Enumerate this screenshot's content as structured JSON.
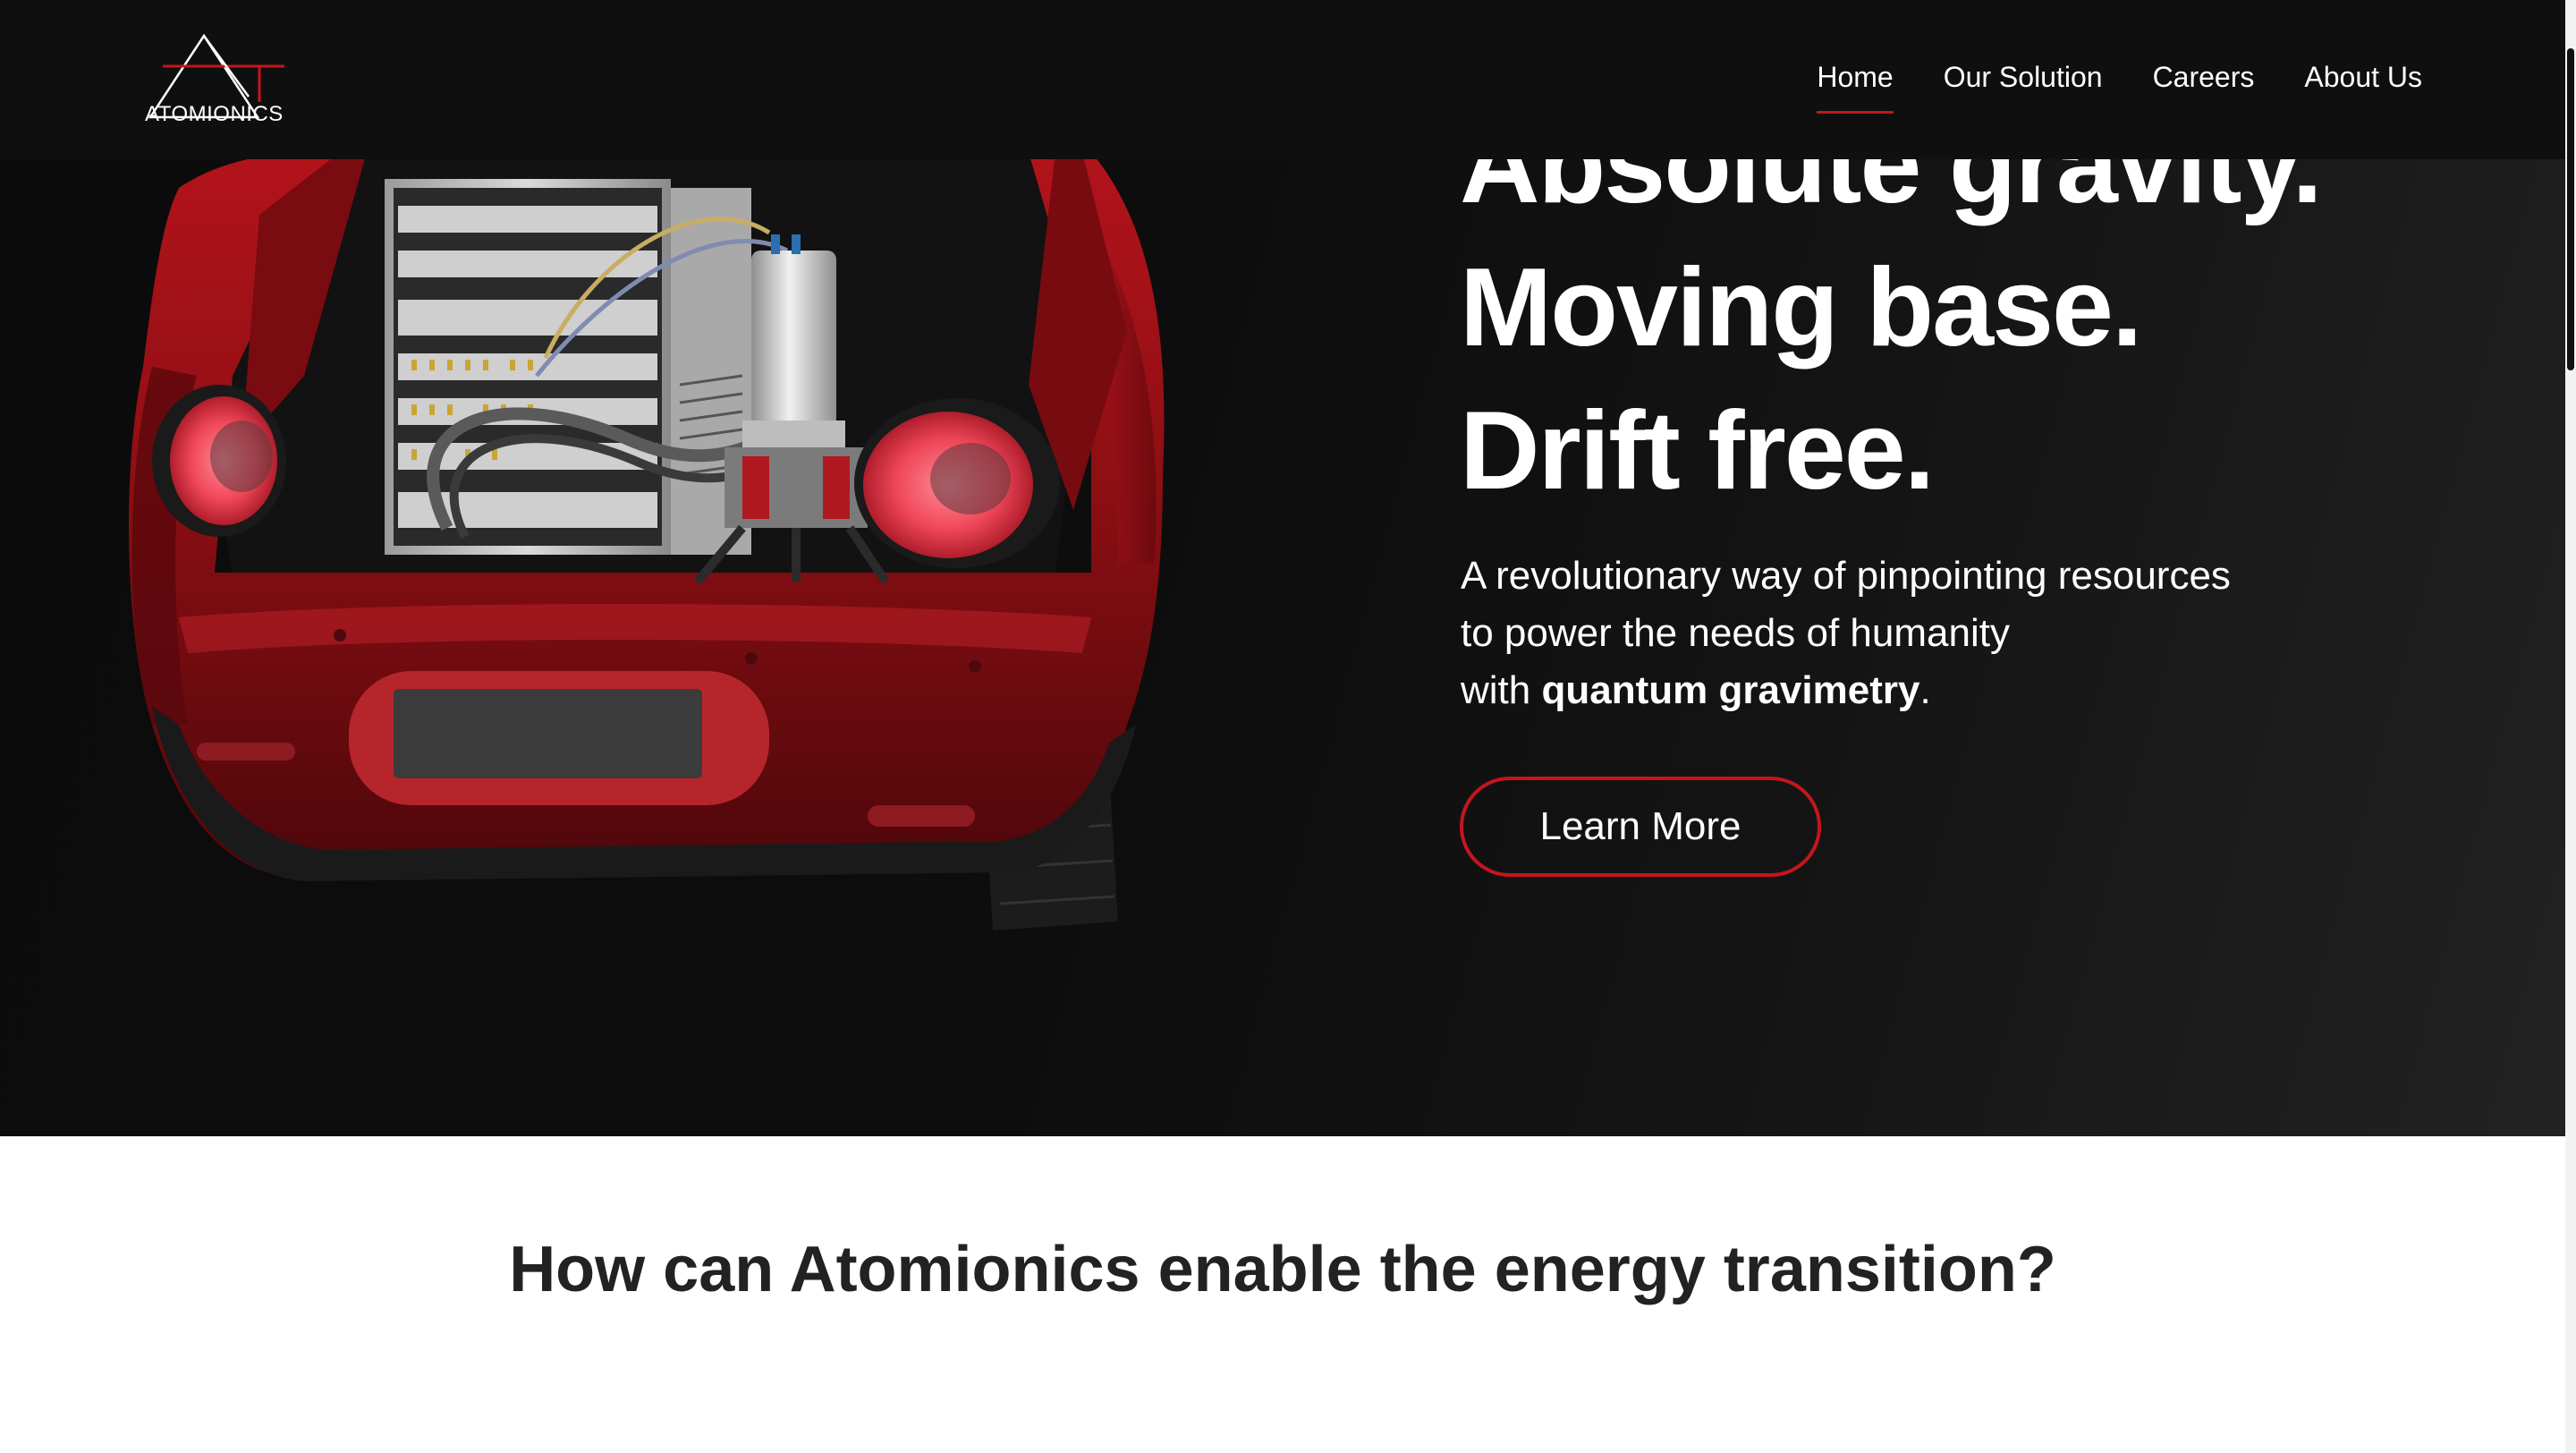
{
  "brand": {
    "logo_text": "ATOMIONICS",
    "accent_color": "#c4161c"
  },
  "nav": {
    "items": [
      {
        "label": "Home",
        "active": true
      },
      {
        "label": "Our Solution",
        "active": false
      },
      {
        "label": "Careers",
        "active": false
      },
      {
        "label": "About Us",
        "active": false
      }
    ]
  },
  "hero": {
    "headline": [
      "Absolute gravity.",
      "Moving base.",
      "Drift free."
    ],
    "subtext_line1": "A revolutionary way of pinpointing resources",
    "subtext_line2": "to power the needs of humanity",
    "subtext_line3_prefix": "with ",
    "subtext_line3_bold": "quantum gravimetry",
    "subtext_line3_suffix": ".",
    "cta_label": "Learn More",
    "image_subject": "car-trunk-with-gravimeter-icon"
  },
  "section": {
    "title": "How can Atomionics enable the energy transition?"
  }
}
